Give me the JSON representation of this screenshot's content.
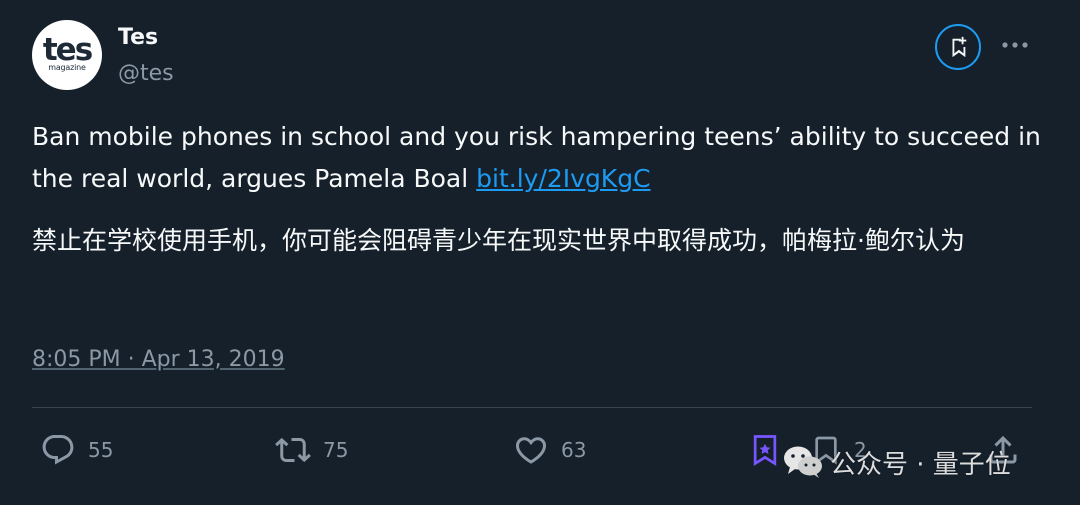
{
  "author": {
    "display_name": "Tes",
    "handle": "@tes",
    "avatar_logo": "tes",
    "avatar_sub": "magazine"
  },
  "tweet": {
    "text": "Ban mobile phones in school and you risk hampering teens’ ability to succeed in the real world, argues Pamela Boal ",
    "link": "bit.ly/2IvgKgC",
    "translation": "禁止在学校使用手机，你可能会阻碍青少年在现实世界中取得成功，帕梅拉·鲍尔认为",
    "timestamp": "8:05 PM · Apr 13, 2019"
  },
  "actions": {
    "replies": "55",
    "retweets": "75",
    "likes": "63",
    "bookmarks": "2"
  },
  "watermark": {
    "text": "公众号 · 量子位"
  },
  "icons": {
    "grok": "grok-icon",
    "more": "more-icon",
    "reply": "reply-icon",
    "retweet": "retweet-icon",
    "like": "heart-icon",
    "bookmark": "bookmark-icon",
    "share": "share-icon",
    "wechat": "wechat-icon"
  },
  "colors": {
    "background": "#15202b",
    "text": "#f7f9f9",
    "secondary": "#8b98a5",
    "link": "#1d9bf0",
    "grok_accent": "#7856ff"
  }
}
